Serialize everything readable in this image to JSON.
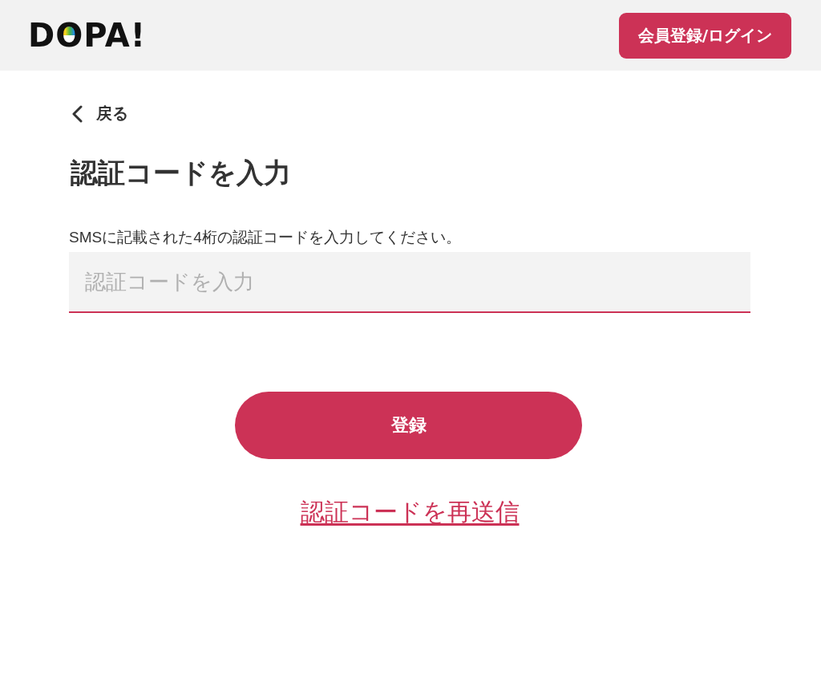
{
  "header": {
    "logo": "DOPA!",
    "login_button": "会員登録/ログイン"
  },
  "back_link": {
    "label": "戻る"
  },
  "title": "認証コードを入力",
  "instruction": "SMSに記載された4桁の認証コードを入力してください。",
  "code_field": {
    "placeholder": "認証コードを入力"
  },
  "submit_button": "登録",
  "resend_link": "認証コードを再送信"
}
